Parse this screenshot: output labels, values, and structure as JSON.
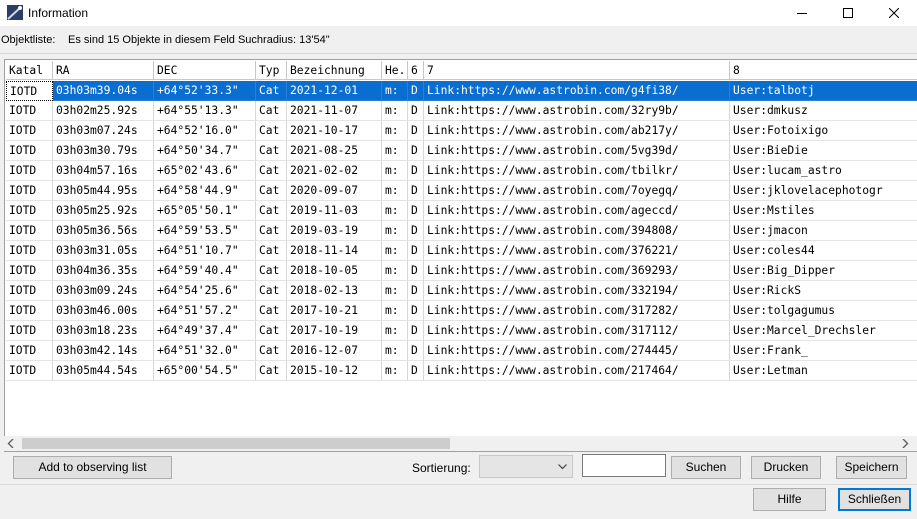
{
  "window": {
    "title": "Information",
    "icon": "comet-icon"
  },
  "info": {
    "label": "Objektliste:",
    "text": "Es sind 15 Objekte in diesem Feld Suchradius: 13'54\""
  },
  "table": {
    "columns": [
      "Katal",
      "RA",
      "DEC",
      "Typ",
      "Bezeichnung",
      "He.",
      "6",
      "7",
      "8"
    ],
    "selected_row": 0,
    "rows": [
      [
        "IOTD",
        "03h03m39.04s",
        "+64°52'33.3\"",
        "Cat",
        "2021-12-01",
        "m:",
        "D",
        "Link:https://www.astrobin.com/g4fi38/",
        "User:talbotj"
      ],
      [
        "IOTD",
        "03h02m25.92s",
        "+64°55'13.3\"",
        "Cat",
        "2021-11-07",
        "m:",
        "D",
        "Link:https://www.astrobin.com/32ry9b/",
        "User:dmkusz"
      ],
      [
        "IOTD",
        "03h03m07.24s",
        "+64°52'16.0\"",
        "Cat",
        "2021-10-17",
        "m:",
        "D",
        "Link:https://www.astrobin.com/ab217y/",
        "User:Fotoixigo"
      ],
      [
        "IOTD",
        "03h03m30.79s",
        "+64°50'34.7\"",
        "Cat",
        "2021-08-25",
        "m:",
        "D",
        "Link:https://www.astrobin.com/5vg39d/",
        "User:BieDie"
      ],
      [
        "IOTD",
        "03h04m57.16s",
        "+65°02'43.6\"",
        "Cat",
        "2021-02-02",
        "m:",
        "D",
        "Link:https://www.astrobin.com/tbilkr/",
        "User:lucam_astro"
      ],
      [
        "IOTD",
        "03h05m44.95s",
        "+64°58'44.9\"",
        "Cat",
        "2020-09-07",
        "m:",
        "D",
        "Link:https://www.astrobin.com/7oyegq/",
        "User:jklovelacephotogr"
      ],
      [
        "IOTD",
        "03h05m25.92s",
        "+65°05'50.1\"",
        "Cat",
        "2019-11-03",
        "m:",
        "D",
        "Link:https://www.astrobin.com/ageccd/",
        "User:Mstiles"
      ],
      [
        "IOTD",
        "03h05m36.56s",
        "+64°59'53.5\"",
        "Cat",
        "2019-03-19",
        "m:",
        "D",
        "Link:https://www.astrobin.com/394808/",
        "User:jmacon"
      ],
      [
        "IOTD",
        "03h03m31.05s",
        "+64°51'10.7\"",
        "Cat",
        "2018-11-14",
        "m:",
        "D",
        "Link:https://www.astrobin.com/376221/",
        "User:coles44"
      ],
      [
        "IOTD",
        "03h04m36.35s",
        "+64°59'40.4\"",
        "Cat",
        "2018-10-05",
        "m:",
        "D",
        "Link:https://www.astrobin.com/369293/",
        "User:Big_Dipper"
      ],
      [
        "IOTD",
        "03h03m09.24s",
        "+64°54'25.6\"",
        "Cat",
        "2018-02-13",
        "m:",
        "D",
        "Link:https://www.astrobin.com/332194/",
        "User:RickS"
      ],
      [
        "IOTD",
        "03h03m46.00s",
        "+64°51'57.2\"",
        "Cat",
        "2017-10-21",
        "m:",
        "D",
        "Link:https://www.astrobin.com/317282/",
        "User:tolgagumus"
      ],
      [
        "IOTD",
        "03h03m18.23s",
        "+64°49'37.4\"",
        "Cat",
        "2017-10-19",
        "m:",
        "D",
        "Link:https://www.astrobin.com/317112/",
        "User:Marcel_Drechsler"
      ],
      [
        "IOTD",
        "03h03m42.14s",
        "+64°51'32.0\"",
        "Cat",
        "2016-12-07",
        "m:",
        "D",
        "Link:https://www.astrobin.com/274445/",
        "User:Frank_"
      ],
      [
        "IOTD",
        "03h05m44.54s",
        "+65°00'54.5\"",
        "Cat",
        "2015-10-12",
        "m:",
        "D",
        "Link:https://www.astrobin.com/217464/",
        "User:Letman"
      ]
    ]
  },
  "toolbar": {
    "add_label": "Add to observing list",
    "sort_label": "Sortierung:",
    "sort_value": "",
    "search_value": "",
    "search_button": "Suchen",
    "print_button": "Drucken",
    "save_button": "Speichern"
  },
  "footer": {
    "help_button": "Hilfe",
    "close_button": "Schließen"
  }
}
